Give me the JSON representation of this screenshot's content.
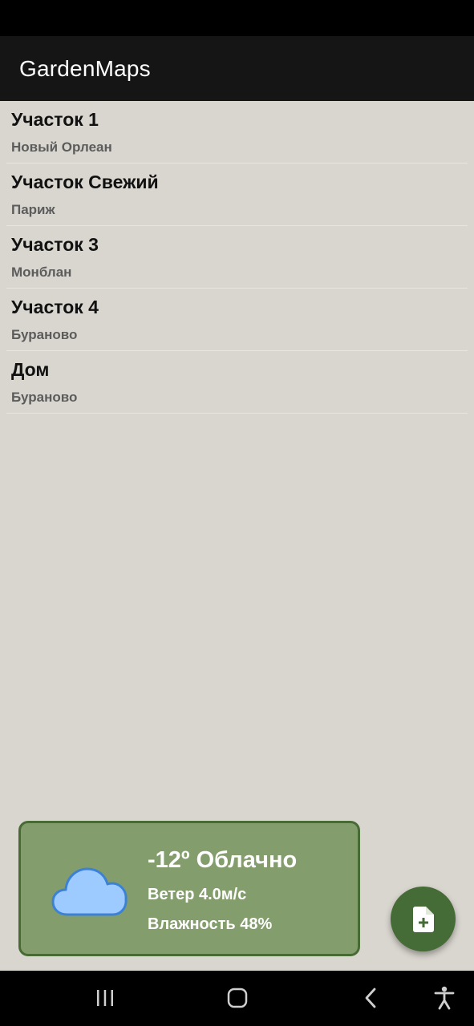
{
  "app": {
    "title": "GardenMaps"
  },
  "plots": [
    {
      "name": "Участок 1",
      "location": "Новый Орлеан"
    },
    {
      "name": "Участок Свежий",
      "location": "Париж"
    },
    {
      "name": "Участок 3",
      "location": "Монблан"
    },
    {
      "name": "Участок 4",
      "location": "Бураново"
    },
    {
      "name": "Дом",
      "location": "Бураново"
    }
  ],
  "weather": {
    "summary": "-12º Облачно",
    "wind": "Ветер 4.0м/с",
    "humidity": "Влажность 48%",
    "icon": "cloud-icon"
  },
  "fab": {
    "icon": "add-document-icon"
  },
  "colors": {
    "background": "#d9d6cf",
    "app_bar": "#151515",
    "card": "#849d6d",
    "card_border": "#486b35",
    "fab": "#456b36",
    "cloud": "#9ecbff"
  }
}
